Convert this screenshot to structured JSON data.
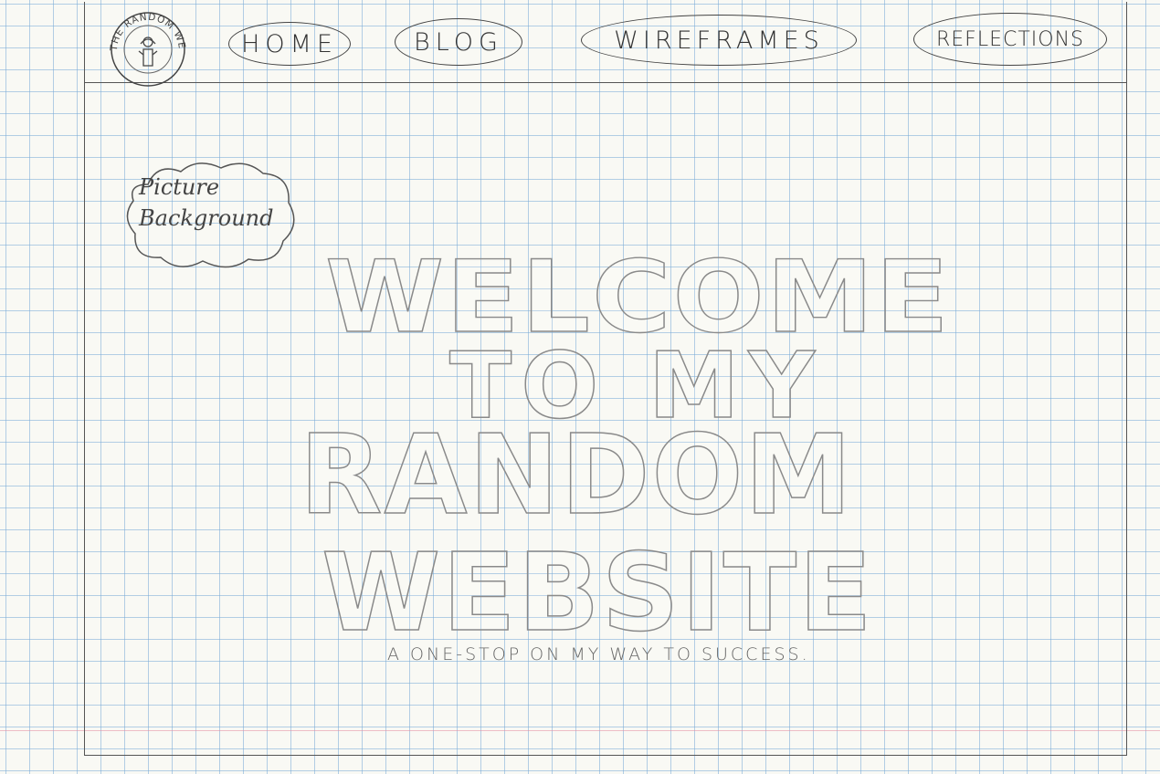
{
  "logo": {
    "text": "THE RANDOM WEBSITE",
    "icon": "person-icon"
  },
  "nav": {
    "items": [
      {
        "label": "HOME"
      },
      {
        "label": "BLOG"
      },
      {
        "label": "WIREFRAMES"
      },
      {
        "label": "REFLECTIONS"
      }
    ]
  },
  "background_note": {
    "line1": "Picture",
    "line2": "Background"
  },
  "hero": {
    "line1": "WELCOME",
    "line2": "TO MY",
    "line3": "RANDOM",
    "line4": "WEBSITE",
    "tagline": "A ONE-STOP ON MY WAY TO SUCCESS."
  },
  "colors": {
    "grid": "#78aad7",
    "ink": "#555555",
    "paper": "#f9f9f4"
  }
}
